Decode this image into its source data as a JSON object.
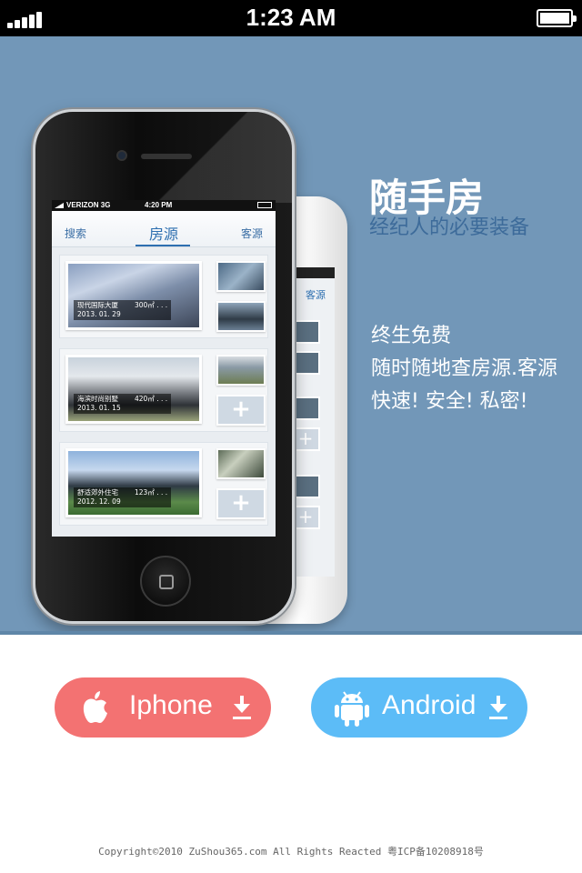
{
  "status_bar": {
    "time": "1:23 AM"
  },
  "phone_screen": {
    "carrier": "VERIZON 3G",
    "time": "4:20 PM",
    "nav": {
      "left": "搜索",
      "center": "房源",
      "right": "客源"
    },
    "listings": [
      {
        "name": "现代国际大厦",
        "area": "300㎡ . . .",
        "date": "2013. 01. 29"
      },
      {
        "name": "海滨时尚别墅",
        "area": "420㎡ . . .",
        "date": "2013. 01. 15"
      },
      {
        "name": "舒适郊外住宅",
        "area": "123㎡ . . .",
        "date": "2012. 12. 09"
      }
    ],
    "add_symbol": "+",
    "back_phone_tab": "客源"
  },
  "hero": {
    "brand": "随手房",
    "tagline": "经纪人的必要装备",
    "features": [
      "终生免费",
      "随时随地查房源.客源",
      "快速! 安全! 私密!"
    ]
  },
  "downloads": {
    "iphone_label": "Iphone",
    "android_label": "Android",
    "iphone_color": "#f37272",
    "android_color": "#5cbcf7"
  },
  "footer": {
    "text": "Copyright©2010 ZuShou365.com All Rights Reacted 粤ICP备10208918号"
  },
  "colors": {
    "hero_background": "#7297b8",
    "accent_blue": "#2d6fb0"
  }
}
